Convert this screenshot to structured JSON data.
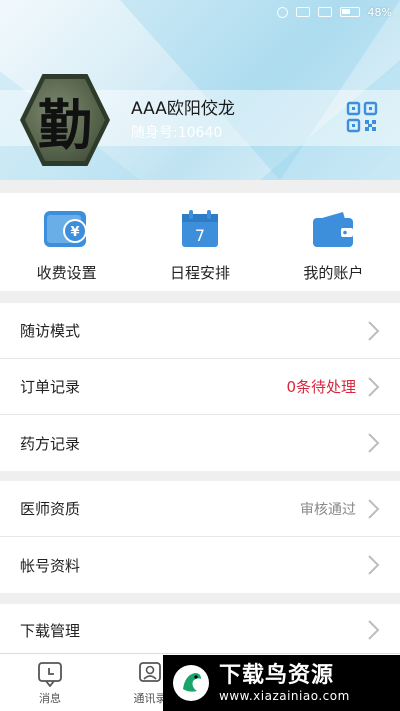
{
  "status_bar": {
    "battery": "48%",
    "icons": [
      "alarm-icon",
      "wifi-icon",
      "signal-icon",
      "battery-icon"
    ]
  },
  "profile": {
    "name": "AAA欧阳佼龙",
    "id_label": "随身号:10640",
    "avatar_char": "勤",
    "qr_icon": "qr-code-icon"
  },
  "quick_actions": [
    {
      "label": "收费设置",
      "icon": "wallet-yen-icon"
    },
    {
      "label": "日程安排",
      "icon": "calendar-icon",
      "badge": "7"
    },
    {
      "label": "我的账户",
      "icon": "wallet-icon"
    }
  ],
  "menu_group_1": [
    {
      "label": "随访模式",
      "value": ""
    },
    {
      "label": "订单记录",
      "value": "0条待处理"
    },
    {
      "label": "药方记录",
      "value": ""
    }
  ],
  "menu_group_2": [
    {
      "label": "医师资质",
      "value": "审核通过"
    },
    {
      "label": "帐号资料",
      "value": ""
    }
  ],
  "menu_group_3": [
    {
      "label": "下载管理",
      "value": ""
    }
  ],
  "bottom_nav": [
    {
      "label": "消息",
      "icon": "message-icon"
    },
    {
      "label": "通讯录",
      "icon": "contacts-icon"
    }
  ],
  "watermark": {
    "title": "下载鸟资源",
    "url": "www.xiazainiao.com"
  },
  "colors": {
    "accent_blue": "#3d8fdc",
    "alert_red": "#d7263d",
    "muted_gray": "#8a8a8a"
  }
}
